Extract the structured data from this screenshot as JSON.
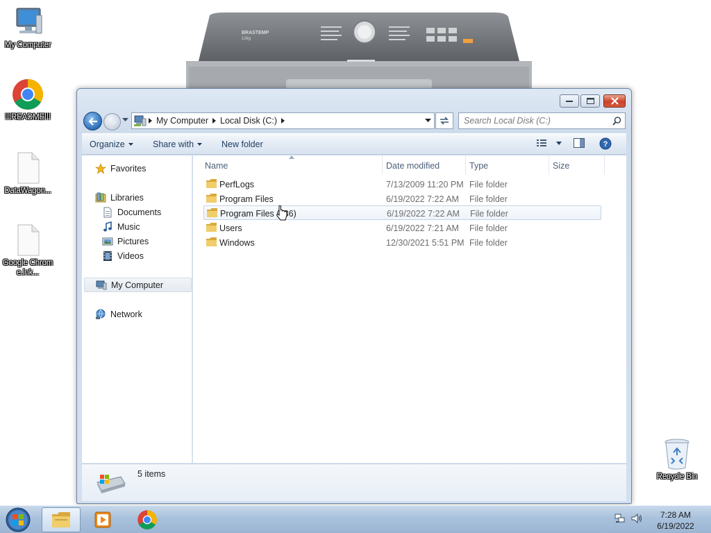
{
  "desktop": {
    "icons": [
      {
        "label": "My Computer",
        "icon": "computer-icon"
      },
      {
        "label": "!!!README!!!",
        "icon": "chrome-icon"
      },
      {
        "label": "DataWagon...",
        "icon": "file-icon"
      },
      {
        "label": "Google Chrome.lnk...",
        "icon": "file-icon"
      },
      {
        "label": "Recycle Bin",
        "icon": "recycle-bin-icon"
      }
    ],
    "wallpaper": {
      "brand": "BRASTEMP",
      "capacity": "12kg"
    }
  },
  "window": {
    "address": {
      "crumbs": [
        "My Computer",
        "Local Disk (C:)"
      ]
    },
    "search": {
      "placeholder": "Search Local Disk (C:)"
    },
    "toolbar": {
      "organize": "Organize",
      "share_with": "Share with",
      "new_folder": "New folder"
    },
    "nav": {
      "favorites": "Favorites",
      "libraries": "Libraries",
      "documents": "Documents",
      "music": "Music",
      "pictures": "Pictures",
      "videos": "Videos",
      "my_computer": "My Computer",
      "network": "Network"
    },
    "columns": {
      "name": "Name",
      "date_modified": "Date modified",
      "type": "Type",
      "size": "Size"
    },
    "files": [
      {
        "name": "PerfLogs",
        "date": "7/13/2009 11:20 PM",
        "type": "File folder"
      },
      {
        "name": "Program Files",
        "date": "6/19/2022 7:22 AM",
        "type": "File folder"
      },
      {
        "name": "Program Files (x86)",
        "date": "6/19/2022 7:22 AM",
        "type": "File folder"
      },
      {
        "name": "Users",
        "date": "6/19/2022 7:21 AM",
        "type": "File folder"
      },
      {
        "name": "Windows",
        "date": "12/30/2021 5:51 PM",
        "type": "File folder"
      }
    ],
    "status": {
      "item_count": "5 items"
    }
  },
  "taskbar": {
    "clock": {
      "time": "7:28 AM",
      "date": "6/19/2022"
    }
  },
  "colors": {
    "accent": "#2d6fbb",
    "folder": "#e8c15a",
    "close": "#c9442a"
  }
}
